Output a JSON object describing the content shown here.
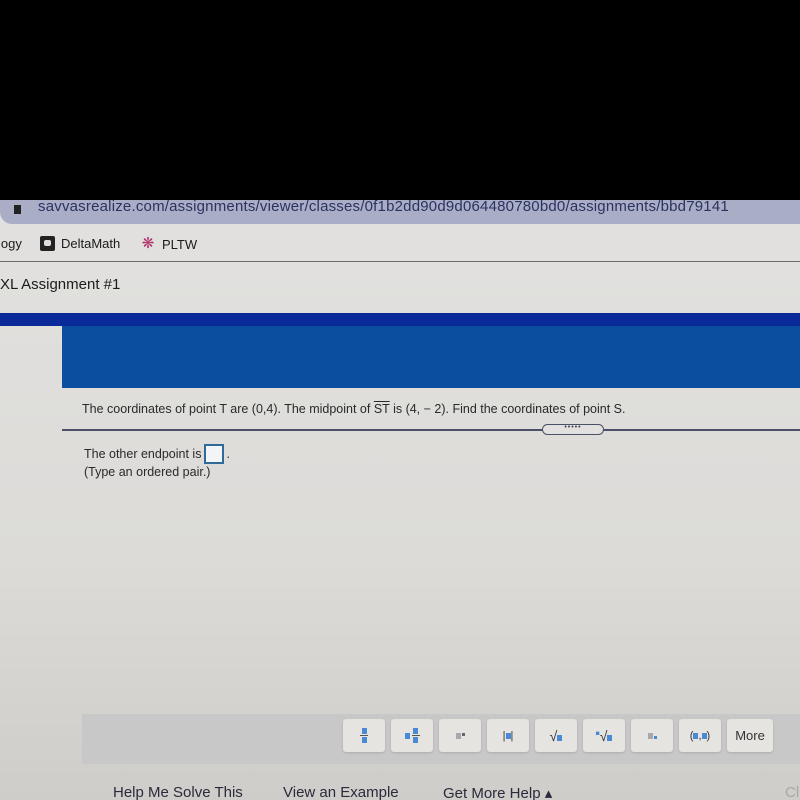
{
  "browser": {
    "url": "savvasrealize.com/assignments/viewer/classes/0f1b2dd90d9d064480780bd0/assignments/bbd79141"
  },
  "bookmarks": [
    {
      "label": "logy",
      "icon": "none"
    },
    {
      "label": "DeltaMath",
      "icon": "graduation-cap-icon"
    },
    {
      "label": "PLTW",
      "icon": "atom-icon"
    }
  ],
  "assignment": {
    "title": "XL Assignment #1"
  },
  "question": {
    "part1": "The coordinates of point T are (0,4). The midpoint of ",
    "segment": "ST",
    "part2": " is (4, − 2). Find the coordinates of point S.",
    "expand_label": "•••••"
  },
  "answer": {
    "prompt": "The other endpoint is",
    "value": "",
    "suffix": ".",
    "hint": "(Type an ordered pair.)"
  },
  "toolbar": {
    "tools": [
      {
        "name": "fraction",
        "label": ""
      },
      {
        "name": "mixed-number",
        "label": ""
      },
      {
        "name": "exponent",
        "label": ""
      },
      {
        "name": "absolute-value",
        "label": "|■|"
      },
      {
        "name": "square-root",
        "label": "√■"
      },
      {
        "name": "nth-root",
        "label": "√■"
      },
      {
        "name": "subscript",
        "label": ""
      },
      {
        "name": "ordered-pair",
        "label": "(■,■)"
      },
      {
        "name": "more",
        "label": "More"
      }
    ]
  },
  "help": {
    "solve": "Help Me Solve This",
    "example": "View an Example",
    "more_help": "Get More Help ▴",
    "clear": "Cl"
  },
  "colors": {
    "header_blue": "#0b4ea0",
    "header_band": "#0a2a9a",
    "answer_box_border": "#2f6a9a"
  }
}
